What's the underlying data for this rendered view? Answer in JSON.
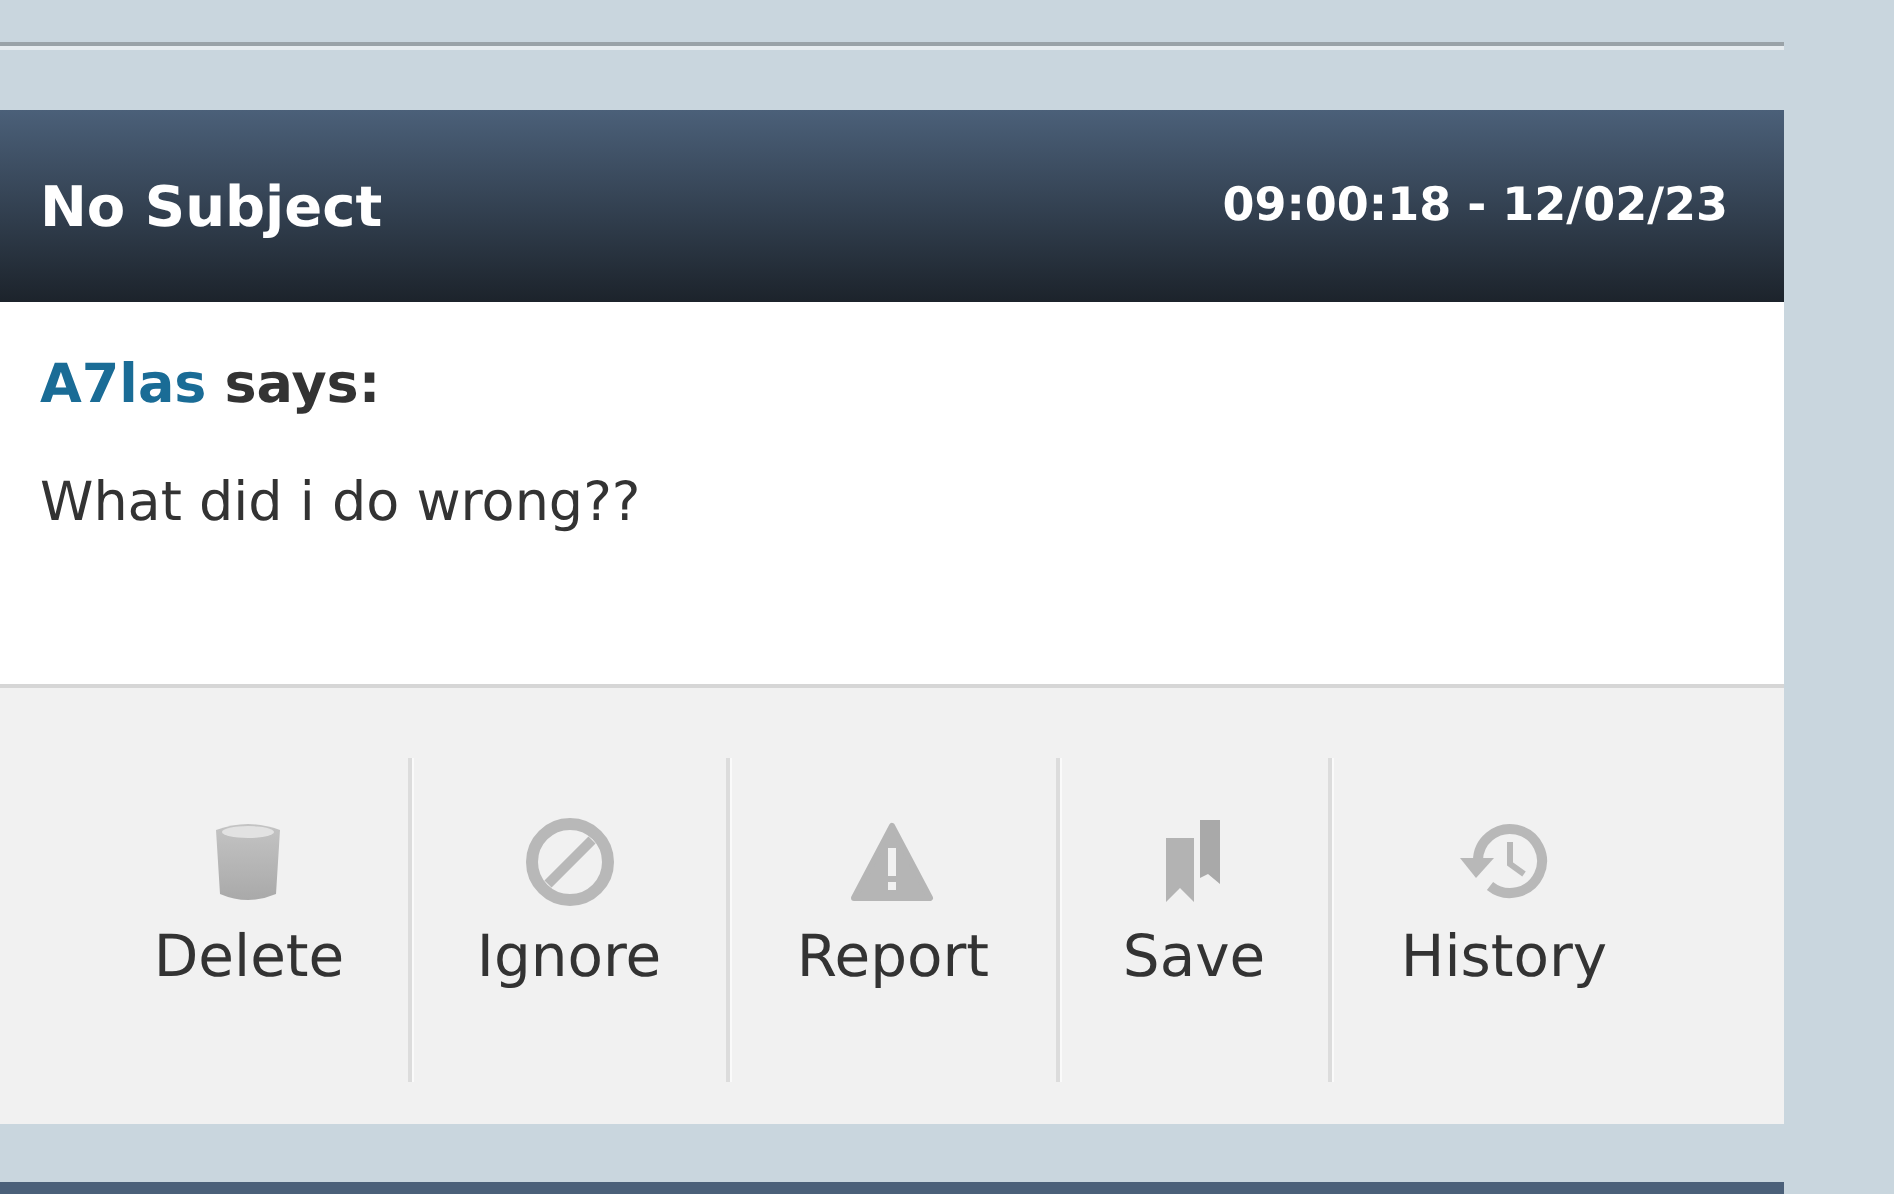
{
  "message": {
    "subject": "No Subject",
    "timestamp": "09:00:18 - 12/02/23",
    "author": "A7las",
    "says": "says:",
    "body": "What did i do wrong??"
  },
  "actions": [
    {
      "label": "Delete",
      "kind": "delete"
    },
    {
      "label": "Ignore",
      "kind": "ignore"
    },
    {
      "label": "Report",
      "kind": "report"
    },
    {
      "label": "Save",
      "kind": "save"
    },
    {
      "label": "History",
      "kind": "history"
    }
  ]
}
